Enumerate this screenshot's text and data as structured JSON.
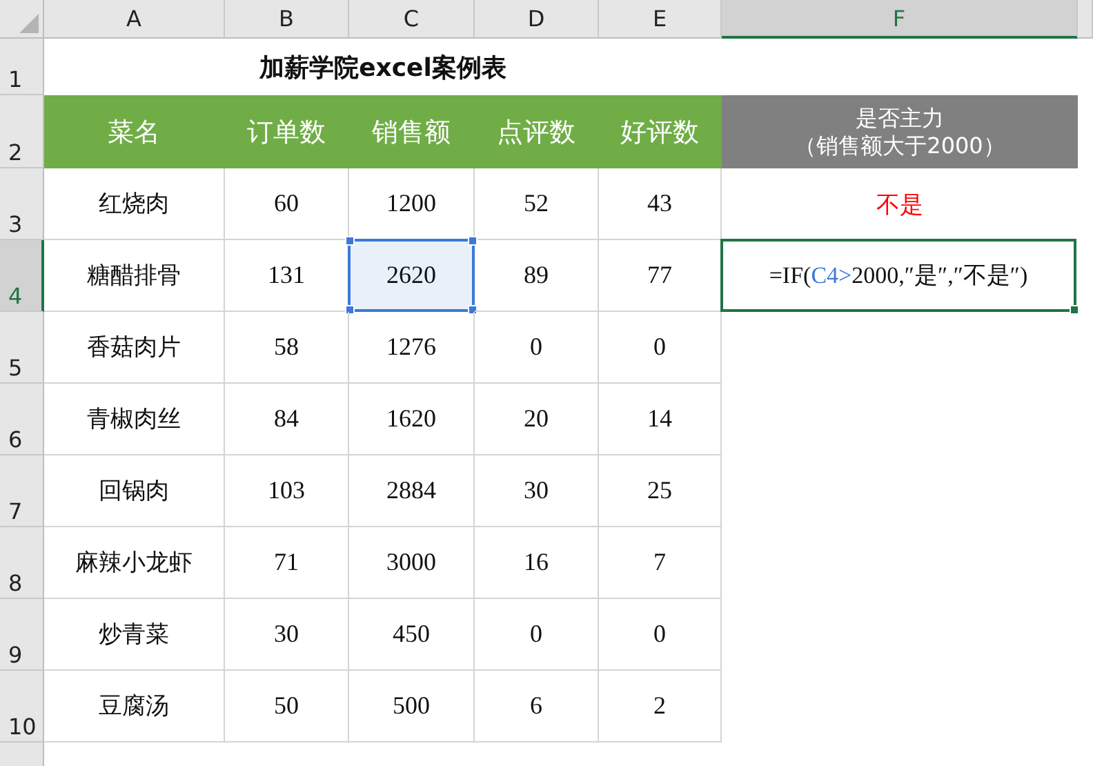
{
  "columns": [
    {
      "label": "A",
      "selected": false
    },
    {
      "label": "B",
      "selected": false
    },
    {
      "label": "C",
      "selected": false
    },
    {
      "label": "D",
      "selected": false
    },
    {
      "label": "E",
      "selected": false
    },
    {
      "label": "F",
      "selected": true
    }
  ],
  "row_headers": [
    {
      "label": "1",
      "selected": false
    },
    {
      "label": "2",
      "selected": false
    },
    {
      "label": "3",
      "selected": false
    },
    {
      "label": "4",
      "selected": true
    },
    {
      "label": "5",
      "selected": false
    },
    {
      "label": "6",
      "selected": false
    },
    {
      "label": "7",
      "selected": false
    },
    {
      "label": "8",
      "selected": false
    },
    {
      "label": "9",
      "selected": false
    },
    {
      "label": "10",
      "selected": false
    }
  ],
  "title": "加薪学院excel案例表",
  "header": [
    "菜名",
    "订单数",
    "销售额",
    "点评数",
    "好评数"
  ],
  "flag_header": [
    "是否主力",
    "（销售额大于2000）"
  ],
  "rows": [
    {
      "cells": [
        {
          "text": "红烧肉",
          "selected": false
        },
        {
          "text": "60",
          "selected": false
        },
        {
          "text": "1200",
          "selected": false
        },
        {
          "text": "52",
          "selected": false
        },
        {
          "text": "43",
          "selected": false
        }
      ],
      "flag": {
        "kind": "result",
        "text": "不是"
      }
    },
    {
      "cells": [
        {
          "text": "糖醋排骨",
          "selected": false
        },
        {
          "text": "131",
          "selected": false
        },
        {
          "text": "2620",
          "selected": true
        },
        {
          "text": "89",
          "selected": false
        },
        {
          "text": "77",
          "selected": false
        }
      ],
      "flag": {
        "kind": "formula",
        "parts": [
          {
            "text": "=IF(",
            "kind": "plain"
          },
          {
            "text": "C4>",
            "kind": "ref"
          },
          {
            "text": "2000,″是″,″不是″)",
            "kind": "plain"
          }
        ]
      }
    },
    {
      "cells": [
        {
          "text": "香菇肉片",
          "selected": false
        },
        {
          "text": "58",
          "selected": false
        },
        {
          "text": "1276",
          "selected": false
        },
        {
          "text": "0",
          "selected": false
        },
        {
          "text": "0",
          "selected": false
        }
      ]
    },
    {
      "cells": [
        {
          "text": "青椒肉丝",
          "selected": false
        },
        {
          "text": "84",
          "selected": false
        },
        {
          "text": "1620",
          "selected": false
        },
        {
          "text": "20",
          "selected": false
        },
        {
          "text": "14",
          "selected": false
        }
      ]
    },
    {
      "cells": [
        {
          "text": "回锅肉",
          "selected": false
        },
        {
          "text": "103",
          "selected": false
        },
        {
          "text": "2884",
          "selected": false
        },
        {
          "text": "30",
          "selected": false
        },
        {
          "text": "25",
          "selected": false
        }
      ]
    },
    {
      "cells": [
        {
          "text": "麻辣小龙虾",
          "selected": false
        },
        {
          "text": "71",
          "selected": false
        },
        {
          "text": "3000",
          "selected": false
        },
        {
          "text": "16",
          "selected": false
        },
        {
          "text": "7",
          "selected": false
        }
      ]
    },
    {
      "cells": [
        {
          "text": "炒青菜",
          "selected": false
        },
        {
          "text": "30",
          "selected": false
        },
        {
          "text": "450",
          "selected": false
        },
        {
          "text": "0",
          "selected": false
        },
        {
          "text": "0",
          "selected": false
        }
      ]
    },
    {
      "cells": [
        {
          "text": "豆腐汤",
          "selected": false
        },
        {
          "text": "50",
          "selected": false
        },
        {
          "text": "500",
          "selected": false
        },
        {
          "text": "6",
          "selected": false
        },
        {
          "text": "2",
          "selected": false
        }
      ]
    }
  ]
}
